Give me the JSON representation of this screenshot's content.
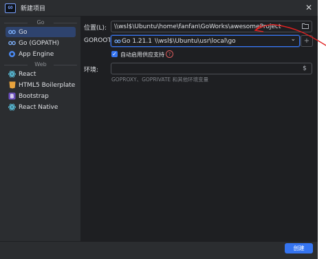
{
  "window": {
    "title": "新建项目",
    "app_icon": "GO"
  },
  "sidebar": {
    "groups": [
      {
        "label": "Go",
        "items": [
          {
            "label": "Go",
            "icon": "go-icon",
            "selected": true
          },
          {
            "label": "Go (GOPATH)",
            "icon": "go-icon"
          },
          {
            "label": "App Engine",
            "icon": "app-engine-icon"
          }
        ]
      },
      {
        "label": "Web",
        "items": [
          {
            "label": "React",
            "icon": "react-icon"
          },
          {
            "label": "HTML5 Boilerplate",
            "icon": "html5-icon"
          },
          {
            "label": "Bootstrap",
            "icon": "bootstrap-icon"
          },
          {
            "label": "React Native",
            "icon": "react-icon"
          }
        ]
      }
    ]
  },
  "form": {
    "location_label": "位置(L):",
    "location_value": "\\\\wsl$\\Ubuntu\\home\\fanfan\\GoWorks\\awesomeProject",
    "goroot_label": "GOROOT:",
    "goroot_version": "Go 1.21.1",
    "goroot_path": "\\\\wsl$\\Ubuntu\\usr\\local\\go",
    "vendor_label": "自动启用供应支持",
    "vendor_checked": true,
    "env_label": "环境:",
    "env_value": "",
    "env_hint": "GOPROXY、GOPRIVATE 和其他环境变量"
  },
  "footer": {
    "create_label": "创建"
  },
  "colors": {
    "accent": "#3574f0",
    "annotation": "#e02020"
  }
}
